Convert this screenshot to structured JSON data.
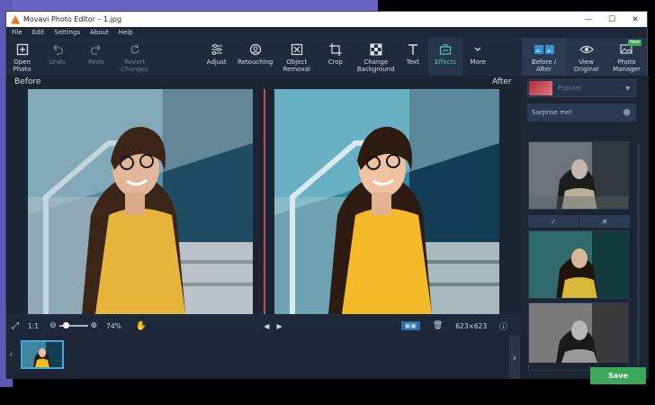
{
  "window": {
    "title": "Movavi Photo Editor – 1.jpg"
  },
  "menu": [
    "File",
    "Edit",
    "Settings",
    "About",
    "Help"
  ],
  "toolbar": {
    "open": "Open Photo",
    "undo": "Undo",
    "redo": "Redo",
    "revert": "Revert Changes",
    "adjust": "Adjust",
    "retouching": "Retouching",
    "object_removal": "Object Removal",
    "crop": "Crop",
    "change_bg": "Change Background",
    "text": "Text",
    "effects": "Effects",
    "more": "More",
    "before_after": "Before / After",
    "view_original": "View Original",
    "photo_manager": "Photo Manager",
    "new_badge": "New"
  },
  "viewer": {
    "before_label": "Before",
    "after_label": "After"
  },
  "bottom": {
    "ratio": "1:1",
    "zoom": "74%",
    "zoom_slider_fraction": 0.15,
    "dimensions": "623×623"
  },
  "panel": {
    "category": "Popular",
    "surprise": "Surprise me!",
    "save": "Save"
  },
  "colors": {
    "accent": "#59c3a4",
    "save": "#3aa858",
    "divider": "#c0504d",
    "thumb_border": "#45a6d8"
  }
}
